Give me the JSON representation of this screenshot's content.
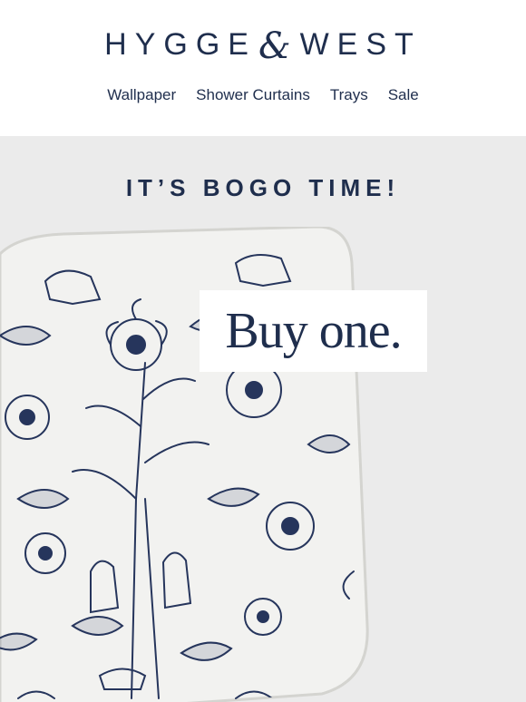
{
  "brand": {
    "name_left": "HYGGE",
    "ampersand": "&",
    "name_right": "WEST"
  },
  "nav": {
    "items": [
      {
        "label": "Wallpaper"
      },
      {
        "label": "Shower Curtains"
      },
      {
        "label": "Trays"
      },
      {
        "label": "Sale"
      }
    ]
  },
  "hero": {
    "headline": "IT’S BOGO TIME!",
    "cta": "Buy one.",
    "image": "patterned-tray-image"
  },
  "colors": {
    "navy": "#1f2e4d",
    "hero_background": "#ebebeb",
    "tray_background": "#f2f2f0"
  }
}
